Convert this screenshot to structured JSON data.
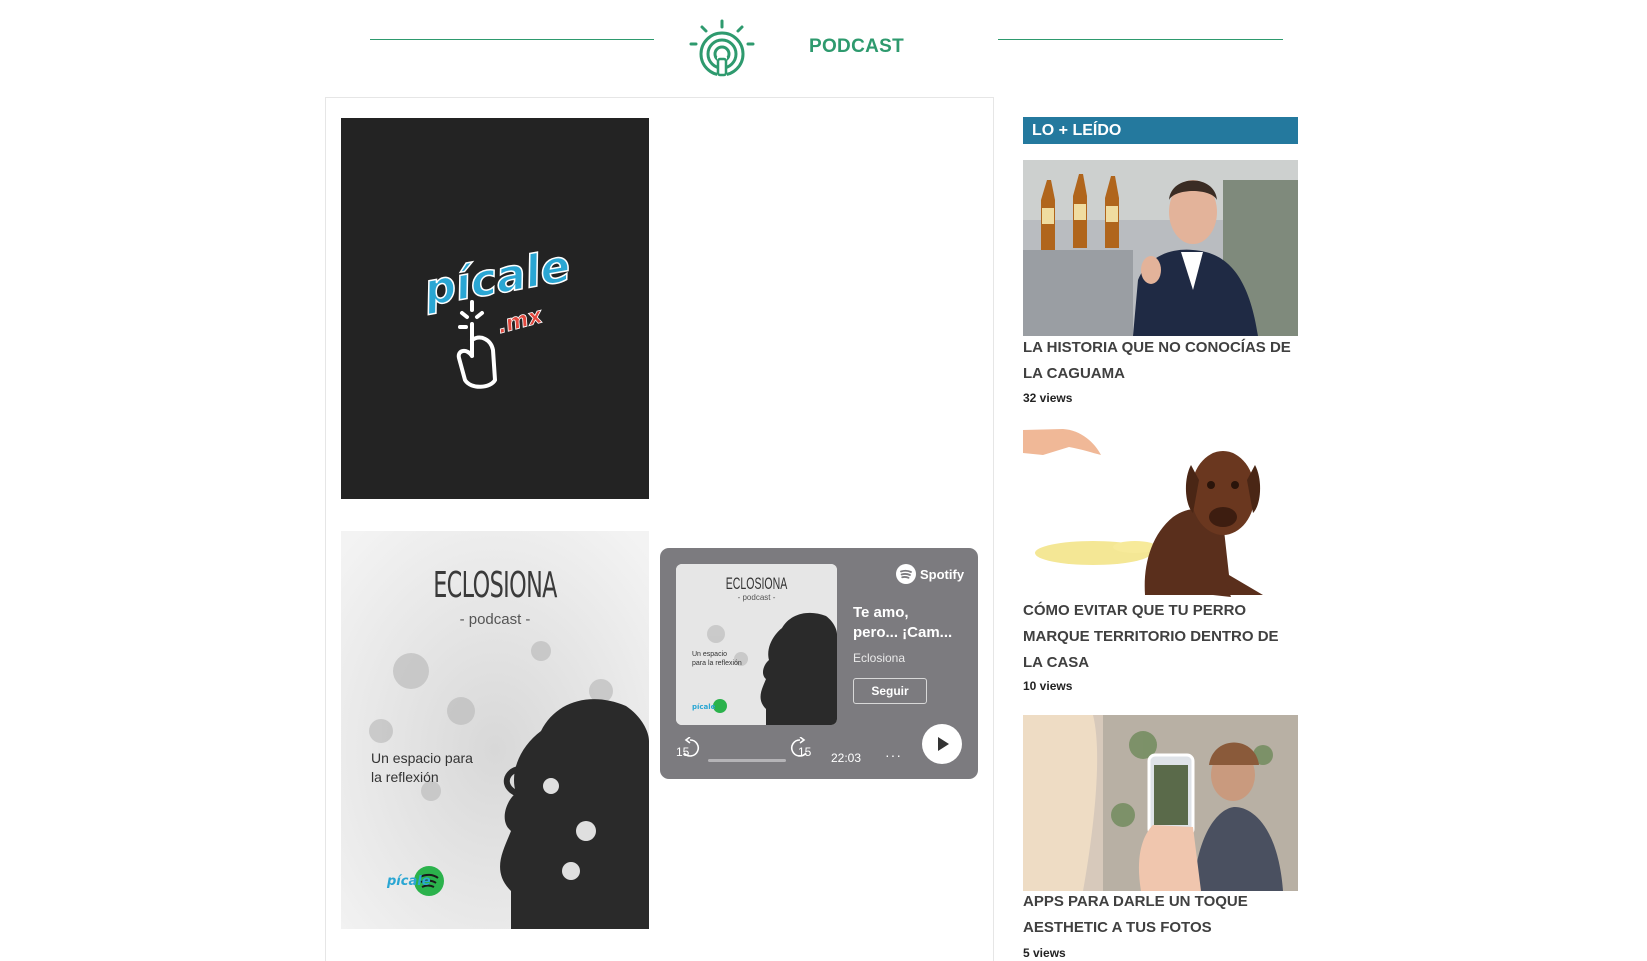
{
  "header": {
    "title": "PODCAST",
    "icon": "podcast-icon",
    "accent_color": "#2e9a6e"
  },
  "podcasts": [
    {
      "name": "picale-cover",
      "logo_text": "pícale",
      "logo_suffix": ".mx",
      "bg_color": "#232323"
    },
    {
      "name": "eclosiona-cover",
      "title": "ECLOSIONA",
      "subtitle": "- podcast -",
      "tagline": "Un espacio para la reflexión"
    }
  ],
  "spotify_embed": {
    "brand": "Spotify",
    "episode_title_line1": "Te amo,",
    "episode_title_line2": "pero... ¡Cam...",
    "artist": "Eclosiona",
    "follow_label": "Seguir",
    "skip_back": "15",
    "skip_forward": "15",
    "duration": "22:03",
    "more": "···",
    "progress": 0,
    "thumb_title": "ECLOSIONA",
    "thumb_subtitle": "- podcast -",
    "thumb_tagline": "Un espacio para la reflexión",
    "bg_color": "#7c7b7f"
  },
  "sidebar": {
    "heading": "LO + LEÍDO",
    "heading_color": "#24799e",
    "articles": [
      {
        "title": "LA HISTORIA QUE NO CONOCÍAS DE LA CAGUAMA",
        "views": "32 views",
        "image": "caguama-photo"
      },
      {
        "title": "CÓMO EVITAR QUE TU PERRO MARQUE TERRITORIO DENTRO DE LA CASA",
        "views": "10 views",
        "image": "dog-photo"
      },
      {
        "title": "APPS PARA DARLE UN TOQUE AESTHETIC A TUS FOTOS",
        "views": "5 views",
        "image": "phone-photo"
      }
    ]
  }
}
